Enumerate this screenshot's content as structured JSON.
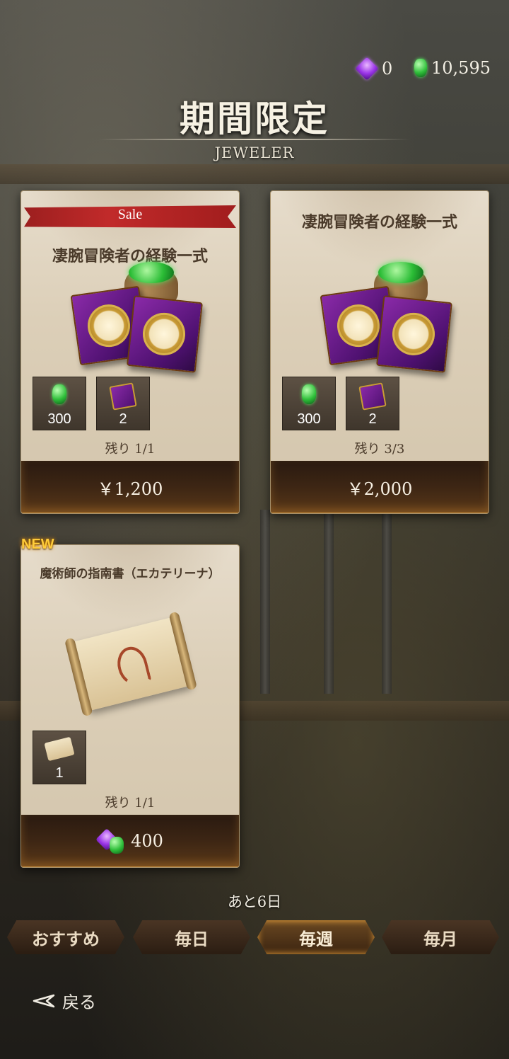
{
  "currency": {
    "premium": "0",
    "gems": "10,595",
    "premium_icon": "purple-gem-icon",
    "gems_icon": "green-gem-icon"
  },
  "header": {
    "title": "期間限定",
    "subtitle": "JEWELER"
  },
  "cards": [
    {
      "badge": "Sale",
      "name": "凄腕冒険者の経験一式",
      "items": [
        {
          "icon": "green-gem-icon",
          "qty": "300"
        },
        {
          "icon": "purple-book-icon",
          "qty": "2"
        }
      ],
      "remaining": "残り 1/1",
      "price": "￥1,200"
    },
    {
      "badge": "",
      "name": "凄腕冒険者の経験一式",
      "items": [
        {
          "icon": "green-gem-icon",
          "qty": "300"
        },
        {
          "icon": "purple-book-icon",
          "qty": "2"
        }
      ],
      "remaining": "残り 3/3",
      "price": "￥2,000"
    },
    {
      "badge": "NEW",
      "name": "魔術師の指南書（エカテリーナ）",
      "items": [
        {
          "icon": "scroll-icon",
          "qty": "1"
        }
      ],
      "remaining": "残り 1/1",
      "price": "400"
    }
  ],
  "time_left": "あと6日",
  "tabs": [
    {
      "label": "おすすめ",
      "active": false
    },
    {
      "label": "毎日",
      "active": false
    },
    {
      "label": "毎週",
      "active": true
    },
    {
      "label": "毎月",
      "active": false
    }
  ],
  "back_label": "戻る",
  "colors": {
    "sale_red": "#b4231f",
    "new_yellow": "#ffcc3a",
    "card_bg": "#dccfb8",
    "tab_active_glow": "#ffb040"
  }
}
